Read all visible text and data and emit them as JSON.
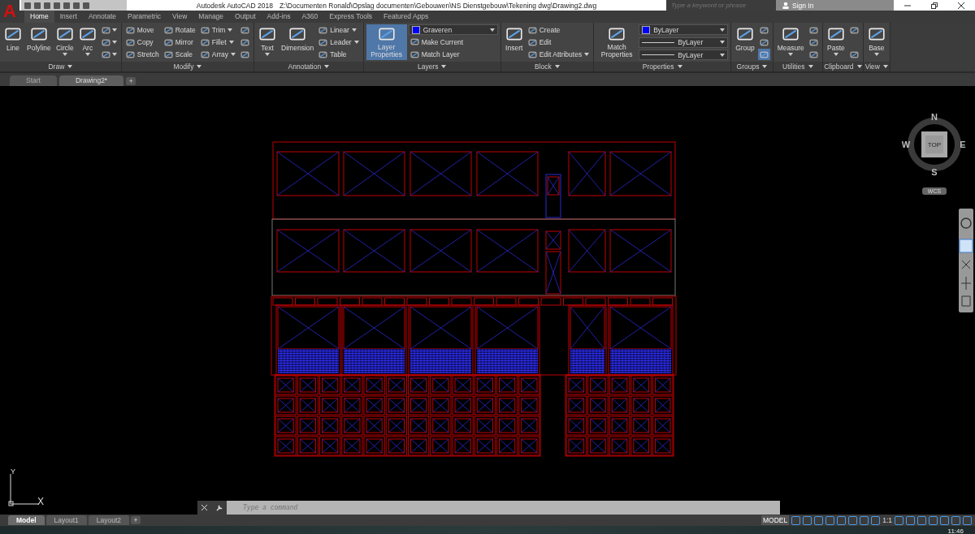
{
  "title_bar": {
    "app_button": "A",
    "app_name": "Autodesk AutoCAD 2018",
    "file_path": "Z:\\Documenten Ronald\\Opslag documenten\\Gebouwen\\NS Dienstgebouw\\Tekening dwg\\Drawing2.dwg",
    "search": {
      "placeholder": "Type a keyword or phrase"
    },
    "sign_in": "Sign In"
  },
  "ribbon_tabs": [
    {
      "label": "Home",
      "selected": true
    },
    {
      "label": "Insert",
      "selected": false
    },
    {
      "label": "Annotate",
      "selected": false
    },
    {
      "label": "Parametric",
      "selected": false
    },
    {
      "label": "View",
      "selected": false
    },
    {
      "label": "Manage",
      "selected": false
    },
    {
      "label": "Output",
      "selected": false
    },
    {
      "label": "Add-ins",
      "selected": false
    },
    {
      "label": "A360",
      "selected": false
    },
    {
      "label": "Express Tools",
      "selected": false
    },
    {
      "label": "Featured Apps",
      "selected": false
    }
  ],
  "panels": [
    {
      "title": "Draw",
      "columns": [
        [
          {
            "kind": "large",
            "label": "Line",
            "menu": false,
            "pressed": false
          }
        ],
        [
          {
            "kind": "large",
            "label": "Polyline",
            "menu": false,
            "pressed": false
          }
        ],
        [
          {
            "kind": "large",
            "label": "Circle",
            "menu": true,
            "pressed": false
          }
        ],
        [
          {
            "kind": "large",
            "label": "Arc",
            "menu": true,
            "pressed": false
          }
        ],
        [
          {
            "kind": "icon",
            "menu": true,
            "pressed": false
          },
          {
            "kind": "icon",
            "menu": true,
            "pressed": false
          },
          {
            "kind": "icon",
            "menu": true,
            "pressed": false
          }
        ]
      ]
    },
    {
      "title": "Modify",
      "columns": [
        [
          {
            "kind": "small",
            "label": "Move",
            "menu": false,
            "pressed": false
          },
          {
            "kind": "small",
            "label": "Copy",
            "menu": false,
            "pressed": false
          },
          {
            "kind": "small",
            "label": "Stretch",
            "menu": false,
            "pressed": false
          }
        ],
        [
          {
            "kind": "small",
            "label": "Rotate",
            "menu": false,
            "pressed": false
          },
          {
            "kind": "small",
            "label": "Mirror",
            "menu": false,
            "pressed": false
          },
          {
            "kind": "small",
            "label": "Scale",
            "menu": false,
            "pressed": false
          }
        ],
        [
          {
            "kind": "small",
            "label": "Trim",
            "menu": true,
            "pressed": false
          },
          {
            "kind": "small",
            "label": "Fillet",
            "menu": true,
            "pressed": false
          },
          {
            "kind": "small",
            "label": "Array",
            "menu": true,
            "pressed": false
          }
        ],
        [
          {
            "kind": "icon",
            "menu": false,
            "pressed": false
          },
          {
            "kind": "icon",
            "menu": false,
            "pressed": false
          },
          {
            "kind": "icon",
            "menu": false,
            "pressed": false
          }
        ]
      ]
    },
    {
      "title": "Annotation",
      "columns": [
        [
          {
            "kind": "large",
            "label": "Text",
            "menu": true,
            "pressed": false
          }
        ],
        [
          {
            "kind": "large",
            "label": "Dimension",
            "menu": false,
            "pressed": false
          }
        ],
        [
          {
            "kind": "small",
            "label": "Linear",
            "menu": true,
            "pressed": false
          },
          {
            "kind": "small",
            "label": "Leader",
            "menu": true,
            "pressed": false
          },
          {
            "kind": "small",
            "label": "Table",
            "menu": false,
            "pressed": false
          }
        ]
      ]
    },
    {
      "title": "Layers",
      "columns": [
        [
          {
            "kind": "large",
            "label": "Layer Properties",
            "menu": false,
            "pressed": true
          }
        ],
        [
          {
            "kind": "layer-combo",
            "value": "Graveren",
            "color": "#0000ff",
            "menu": true,
            "pressed": false
          },
          {
            "kind": "small",
            "label": "Make Current",
            "menu": false,
            "pressed": false
          },
          {
            "kind": "small",
            "label": "Match Layer",
            "menu": false,
            "pressed": false
          }
        ]
      ]
    },
    {
      "title": "Block",
      "columns": [
        [
          {
            "kind": "large",
            "label": "Insert",
            "menu": false,
            "pressed": false
          }
        ],
        [
          {
            "kind": "small",
            "label": "Create",
            "menu": false,
            "pressed": false
          },
          {
            "kind": "small",
            "label": "Edit",
            "menu": false,
            "pressed": false
          },
          {
            "kind": "small",
            "label": "Edit Attributes",
            "menu": true,
            "pressed": false
          }
        ]
      ]
    },
    {
      "title": "Properties",
      "columns": [
        [
          {
            "kind": "large",
            "label": "Match Properties",
            "menu": false,
            "pressed": false
          }
        ],
        [
          {
            "kind": "color-combo",
            "value": "ByLayer",
            "color": "#0000ff",
            "menu": true,
            "pressed": false
          },
          {
            "kind": "line-combo",
            "value": "ByLayer",
            "menu": true,
            "pressed": false
          },
          {
            "kind": "line-combo",
            "value": "ByLayer",
            "menu": true,
            "pressed": false
          }
        ]
      ]
    },
    {
      "title": "Groups",
      "columns": [
        [
          {
            "kind": "large",
            "label": "Group",
            "menu": false,
            "pressed": false
          }
        ],
        [
          {
            "kind": "icon",
            "menu": false,
            "pressed": false
          },
          {
            "kind": "icon",
            "menu": false,
            "pressed": false
          },
          {
            "kind": "icon",
            "menu": false,
            "pressed": true
          }
        ]
      ]
    },
    {
      "title": "Utilities",
      "columns": [
        [
          {
            "kind": "large",
            "label": "Measure",
            "menu": true,
            "pressed": false
          }
        ],
        [
          {
            "kind": "icon",
            "menu": false,
            "pressed": false
          },
          {
            "kind": "icon",
            "menu": false,
            "pressed": false
          },
          {
            "kind": "icon",
            "menu": false,
            "pressed": false
          }
        ]
      ]
    },
    {
      "title": "Clipboard",
      "columns": [
        [
          {
            "kind": "large",
            "label": "Paste",
            "menu": true,
            "pressed": false
          }
        ],
        [
          {
            "kind": "icon",
            "menu": false,
            "pressed": false
          },
          {
            "kind": "icon",
            "menu": false,
            "pressed": false
          }
        ]
      ]
    },
    {
      "title": "View",
      "columns": [
        [
          {
            "kind": "large",
            "label": "Base",
            "menu": true,
            "pressed": false
          }
        ]
      ]
    }
  ],
  "file_tabs": [
    {
      "label": "Start",
      "selected": false
    },
    {
      "label": "Drawing2*",
      "selected": true
    }
  ],
  "new_file_tab": "+",
  "view_cube": {
    "north": "N",
    "east": "E",
    "south": "S",
    "west": "W",
    "face": "TOP",
    "ucs_menu": "WCS"
  },
  "ucs_icon": {
    "x_label": "X",
    "y_label": "Y"
  },
  "command_line": {
    "placeholder": "Type a command"
  },
  "layout_tabs": [
    {
      "label": "Model",
      "selected": true
    },
    {
      "label": "Layout1",
      "selected": false
    },
    {
      "label": "Layout2",
      "selected": false
    }
  ],
  "new_layout_tab": "+",
  "status_bar": {
    "space": "MODEL",
    "scale": "1:1"
  },
  "taskbar": {
    "time": "11:46"
  }
}
